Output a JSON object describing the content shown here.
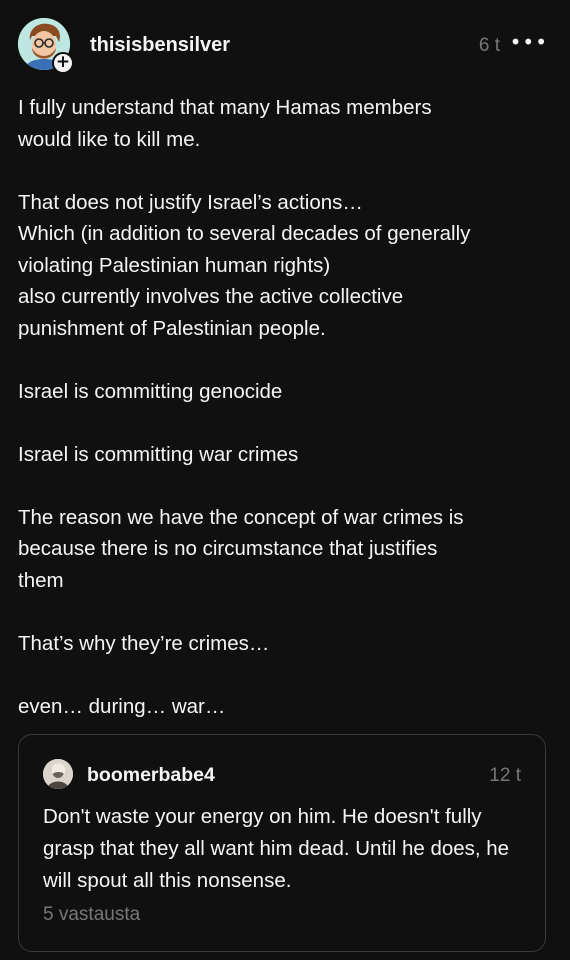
{
  "post": {
    "username": "thisisbensilver",
    "time": "6 t",
    "more_icon": "more-horizontal-icon",
    "follow_badge": "+",
    "text": "I fully understand that many Hamas members\nwould like to kill me.\n\nThat does not justify Israel’s actions…\nWhich (in addition to several decades of generally\nviolating Palestinian human rights)\nalso currently involves the active collective\npunishment of Palestinian people.\n\nIsrael is committing genocide\n\nIsrael is committing war crimes\n\nThe reason we have the concept of war crimes is\nbecause there is no circumstance that justifies\nthem\n\nThat’s why they’re crimes…\n\neven… during… war…"
  },
  "quoted_post": {
    "username": "boomerbabe4",
    "time": "12 t",
    "text": "Don't waste your energy on him. He doesn't fully grasp that they all want him dead. Until he does, he will spout all this nonsense.",
    "replies": "5 vastausta"
  },
  "colors": {
    "background": "#101010",
    "text": "#f3f5f7",
    "secondary_text": "#777777",
    "border": "#3a3a3a"
  }
}
